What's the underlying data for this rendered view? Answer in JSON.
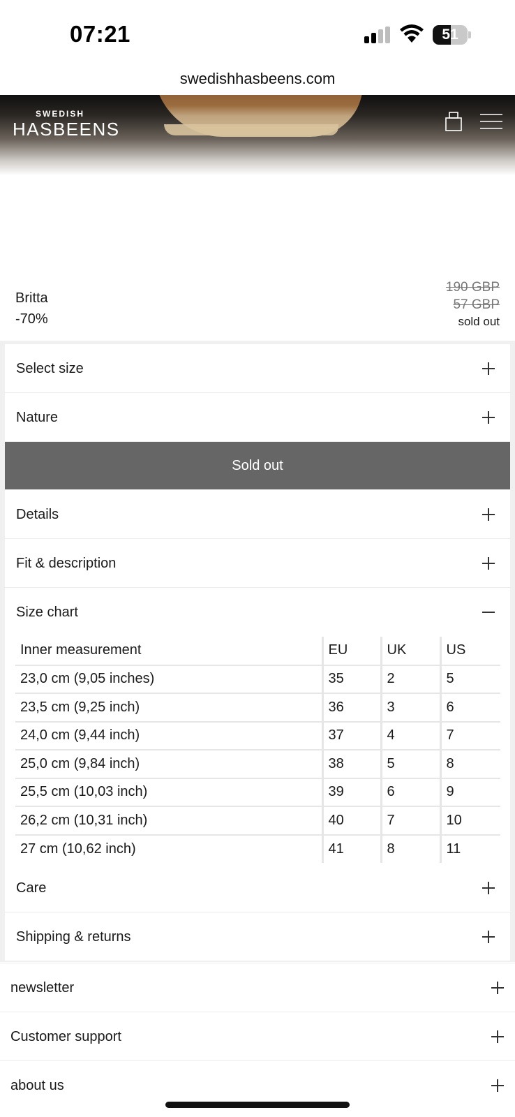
{
  "status_bar": {
    "time": "07:21",
    "battery_level": 51,
    "battery_text": "51"
  },
  "browser": {
    "url": "swedishhasbeens.com"
  },
  "header": {
    "logo_top": "SWEDISH",
    "logo_main": "HASBEENS",
    "cart_icon": "shopping-bag-icon",
    "menu_icon": "hamburger-menu-icon"
  },
  "product": {
    "name": "Britta",
    "discount": "-70%",
    "original_price": "190 GBP",
    "sale_price": "57 GBP",
    "availability": "sold out"
  },
  "accordion": {
    "select_size": "Select size",
    "nature": "Nature",
    "sold_out_button": "Sold out",
    "details": "Details",
    "fit_description": "Fit & description",
    "size_chart": "Size chart",
    "care": "Care",
    "shipping_returns": "Shipping & returns"
  },
  "size_chart": {
    "headers": [
      "Inner measurement",
      "EU",
      "UK",
      "US"
    ],
    "rows": [
      [
        "23,0 cm (9,05 inches)",
        "35",
        "2",
        "5"
      ],
      [
        "23,5 cm (9,25 inch)",
        "36",
        "3",
        "6"
      ],
      [
        "24,0 cm (9,44 inch)",
        "37",
        "4",
        "7"
      ],
      [
        "25,0 cm (9,84 inch)",
        "38",
        "5",
        "8"
      ],
      [
        "25,5 cm (10,03 inch)",
        "39",
        "6",
        "9"
      ],
      [
        "26,2 cm (10,31 inch)",
        "40",
        "7",
        "10"
      ],
      [
        "27 cm (10,62 inch)",
        "41",
        "8",
        "11"
      ]
    ]
  },
  "footer": {
    "newsletter": "newsletter",
    "customer_support": "Customer support",
    "about_us": "about us"
  },
  "colors": {
    "sold_out_button_bg": "#666666",
    "panel_bg": "#f0f0f0"
  }
}
